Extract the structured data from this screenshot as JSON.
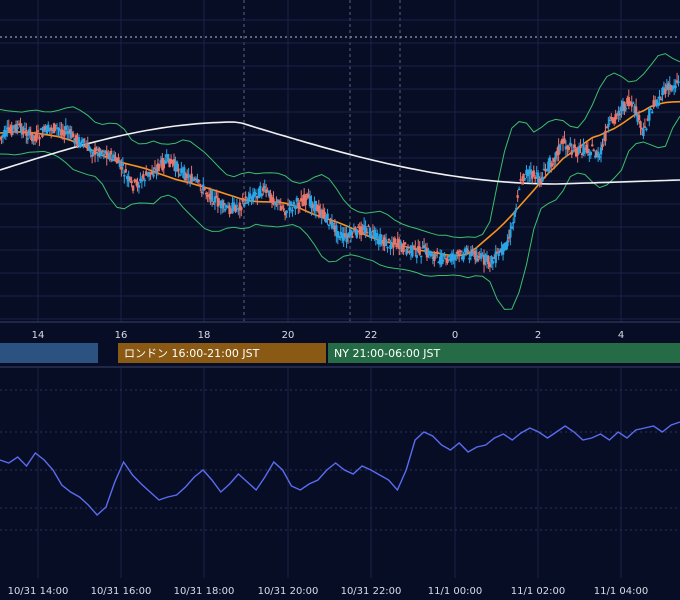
{
  "colors": {
    "background": "#080d26",
    "grid": "#1a2246",
    "candle_up": "#2aa6e6",
    "candle_down": "#e9766b",
    "ma_orange": "#f7931e",
    "ma_white": "#f0f0f0",
    "bollinger": "#3bbf6a",
    "rsi_line": "#5a6cf0",
    "session_tokyo": "#2c5282",
    "session_london": "#8a5a14",
    "session_ny": "#256b45"
  },
  "main_x_ticks": [
    "14",
    "16",
    "18",
    "20",
    "22",
    "0",
    "2",
    "4"
  ],
  "sessions": [
    {
      "label": ""
    },
    {
      "label": "ロンドン 16:00-21:00 JST"
    },
    {
      "label": "NY 21:00-06:00 JST"
    }
  ],
  "bottom_x_ticks": [
    "10/31 14:00",
    "10/31 16:00",
    "10/31 18:00",
    "10/31 20:00",
    "10/31 22:00",
    "11/1 00:00",
    "11/1 02:00",
    "11/1 04:00"
  ],
  "chart_data": {
    "type": "candlestick",
    "title": "",
    "price_path": [
      138,
      133,
      127,
      129,
      135,
      137,
      132,
      128,
      129,
      131,
      137,
      142,
      148,
      152,
      150,
      155,
      161,
      172,
      186,
      183,
      176,
      171,
      165,
      160,
      166,
      172,
      178,
      184,
      190,
      196,
      204,
      210,
      207,
      205,
      198,
      194,
      190,
      196,
      203,
      210,
      206,
      202,
      199,
      205,
      213,
      221,
      230,
      238,
      236,
      231,
      228,
      235,
      240,
      244,
      242,
      247,
      250,
      252,
      251,
      254,
      258,
      261,
      257,
      255,
      252,
      255,
      259,
      262,
      256,
      248,
      230,
      186,
      172,
      176,
      180,
      165,
      155,
      142,
      148,
      152,
      148,
      150,
      158,
      130,
      118,
      108,
      103,
      112,
      134,
      110,
      100,
      90,
      86,
      80
    ],
    "rsi_path": [
      460,
      463,
      457,
      466,
      453,
      460,
      470,
      485,
      492,
      497,
      505,
      515,
      507,
      482,
      462,
      475,
      484,
      492,
      500,
      497,
      495,
      487,
      477,
      470,
      480,
      492,
      484,
      474,
      482,
      490,
      477,
      462,
      470,
      486,
      490,
      484,
      480,
      470,
      463,
      470,
      474,
      466,
      470,
      475,
      480,
      490,
      470,
      440,
      432,
      436,
      445,
      450,
      443,
      452,
      447,
      445,
      438,
      434,
      440,
      433,
      428,
      432,
      438,
      432,
      426,
      432,
      440,
      438,
      434,
      440,
      432,
      438,
      430,
      428,
      426,
      432,
      425,
      422
    ],
    "bands": "bollinger",
    "moving_averages": [
      "short",
      "long"
    ]
  }
}
